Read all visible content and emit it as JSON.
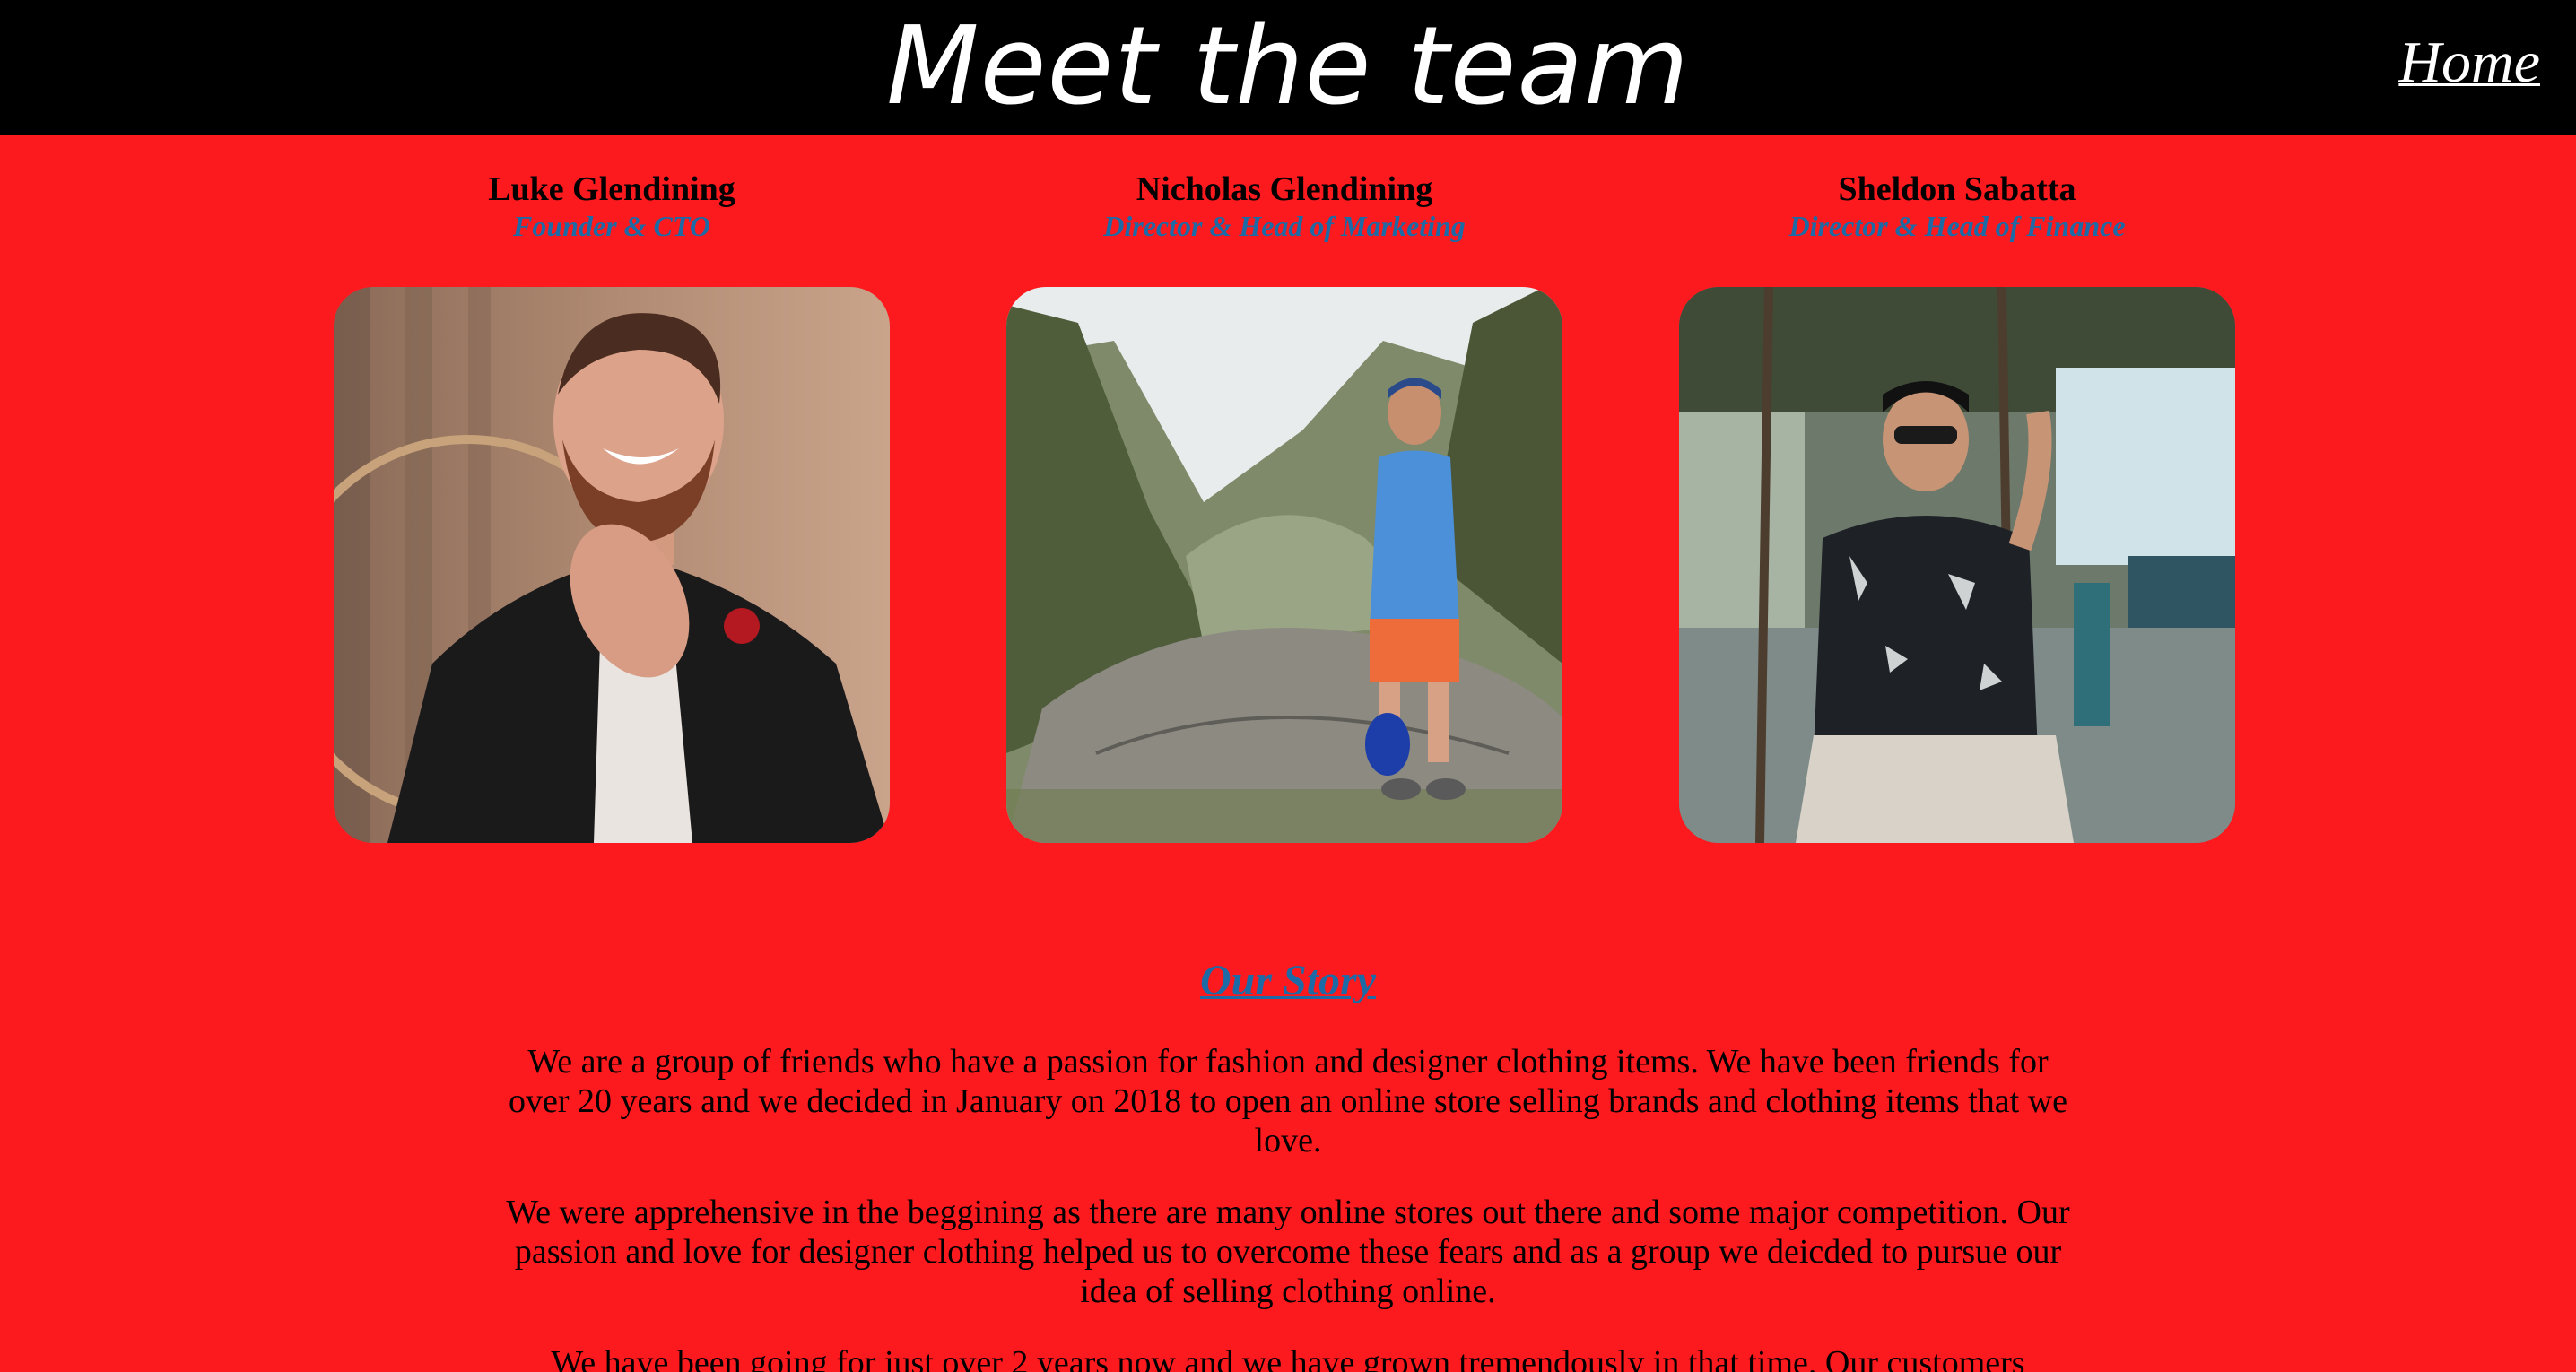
{
  "header": {
    "title": "Meet the team",
    "home_label": "Home"
  },
  "team": [
    {
      "name": "Luke Glendining",
      "role": "Founder & CTO"
    },
    {
      "name": "Nicholas Glendining",
      "role": "Director & Head of Marketing"
    },
    {
      "name": "Sheldon Sabatta",
      "role": "Director & Head of Finance"
    }
  ],
  "story": {
    "heading": "Our Story",
    "paragraphs": [
      "We are a group of friends who have a passion for fashion and designer clothing items. We have been friends for over 20 years and we decided in January on 2018 to open an online store selling brands and clothing items that we love.",
      "We were apprehensive in the beggining as there are many online stores out there and some major competition. Our passion and love for designer clothing helped us to overcome these fears and as a group we deicded to pursue our idea of selling clothing online.",
      "We have been going for just over 2 years now and we have grown tremendously in that time. Our customers"
    ]
  },
  "colors": {
    "background": "#fd1a1e",
    "header_bg": "#000000",
    "accent": "#1c6aa6"
  }
}
